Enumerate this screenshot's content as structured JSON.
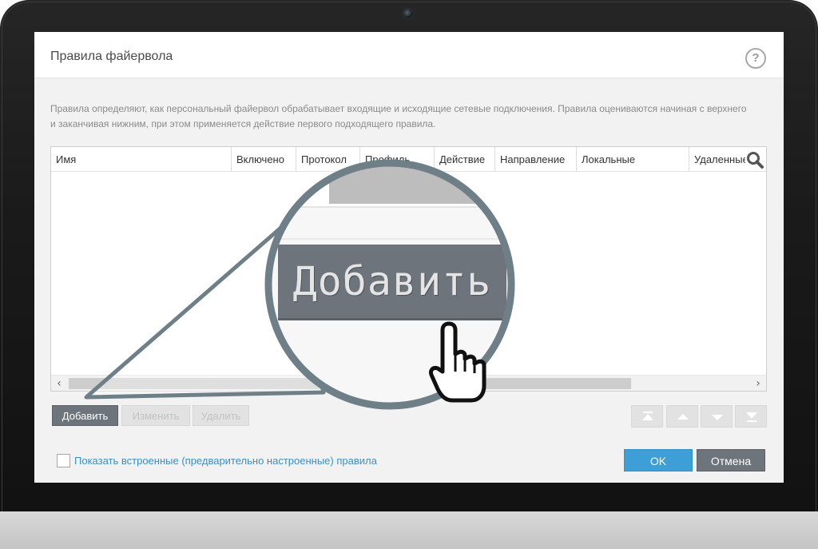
{
  "dialog": {
    "title": "Правила файервола",
    "help_glyph": "?",
    "description": "Правила определяют, как персональный файервол обрабатывает входящие и исходящие сетевые подключения. Правила оцениваются начиная с верхнего и заканчивая нижним, при этом применяется действие первого подходящего правила."
  },
  "table": {
    "columns": [
      {
        "label": "Имя"
      },
      {
        "label": "Включено"
      },
      {
        "label": "Протокол"
      },
      {
        "label": "Профиль"
      },
      {
        "label": "Действие"
      },
      {
        "label": "Направление"
      },
      {
        "label": "Локальные"
      },
      {
        "label": "Удаленные"
      }
    ],
    "rows": []
  },
  "buttons": {
    "add_label": "Добавить",
    "edit_label": "Изменить",
    "delete_label": "Удалить"
  },
  "footer": {
    "show_builtin_label": "Показать встроенные (предварительно настроенные) правила",
    "show_builtin_checked": false,
    "ok_label": "OK",
    "cancel_label": "Отмена"
  },
  "magnifier": {
    "zoom_label": "Добавить"
  },
  "colors": {
    "accent": "#3d9fd6",
    "primary_button": "#6d747b",
    "link": "#3b8ec6"
  },
  "icons": {
    "help": "help-icon",
    "search": "search-icon",
    "move_top": "move-top-icon",
    "move_up": "move-up-icon",
    "move_down": "move-down-icon",
    "move_bottom": "move-bottom-icon",
    "cursor": "hand-cursor-icon"
  }
}
